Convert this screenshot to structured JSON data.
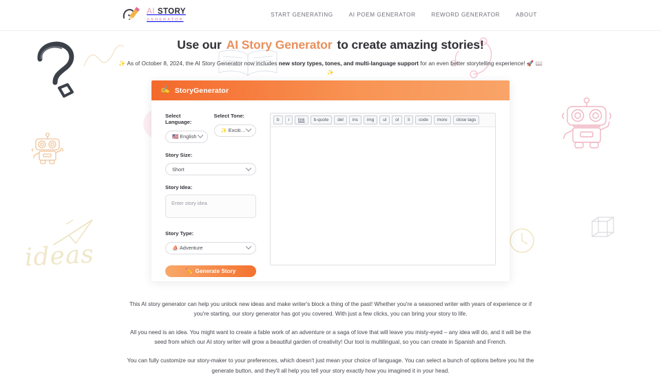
{
  "header": {
    "logo": {
      "icon": "pencil-logo-icon",
      "line1_prefix": "AI ",
      "line1_bold": "STORY",
      "line2": "GENERATOR"
    },
    "nav": [
      {
        "label": "START GENERATING",
        "name": "nav-start-generating"
      },
      {
        "label": "AI POEM GENERATOR",
        "name": "nav-ai-poem-generator"
      },
      {
        "label": "REWORD GENERATOR",
        "name": "nav-reword-generator"
      },
      {
        "label": "ABOUT",
        "name": "nav-about"
      }
    ]
  },
  "hero": {
    "title_before": "Use our",
    "title_accent": "AI Story Generator",
    "title_after": "to create amazing stories!",
    "notice_lead_icon": "✨",
    "notice_part1": "As of October 8, 2024, the AI Story Generator now includes ",
    "notice_bold": "new story types, tones, and multi-language support",
    "notice_part2": " for an even better storytelling experience! 🚀",
    "notice_trail": "📖✨"
  },
  "card": {
    "head_icon": "✍️",
    "head_title": "StoryGenerator",
    "fields": {
      "language_label": "Select Language:",
      "language_value": "🇺🇸 English",
      "tone_label": "Select Tone:",
      "tone_value": "✨ Exciting",
      "size_label": "Story Size:",
      "size_value": "Short",
      "idea_label": "Story Idea:",
      "idea_placeholder": "Enter story idea",
      "idea_value": "",
      "type_label": "Story Type:",
      "type_value": "⛵ Adventure"
    },
    "generate_button": {
      "icon": "✏️",
      "label": "Generate Story"
    },
    "editor": {
      "quicktags": [
        "b",
        "i",
        "link",
        "b-quote",
        "del",
        "ins",
        "img",
        "ul",
        "ol",
        "li",
        "code",
        "more",
        "close tags"
      ],
      "content": ""
    }
  },
  "copy": {
    "paragraphs": [
      "This AI story generator can help you unlock new ideas and make writer's block a thing of the past! Whether you're a seasoned writer with years of experience or if you're starting, our story generator has got you covered. With just a few clicks, you can bring your story to life.",
      "All you need is an idea. You might want to create a fable work of an adventure or a saga of love that will leave you misty-eyed – any idea will do, and it will be the seed from which our AI story writer will grow a beautiful garden of creativity! Our tool is multilingual, so you can create in Spanish and French.",
      "You can fully customize our story-maker to your preferences, which doesn't just mean your choice of language. You can select a bunch of options before you hit the generate button, and they'll all help you tell your story exactly how you imagined it in your head."
    ]
  },
  "decorations": {
    "ideas_word": "ideas",
    "colors": {
      "accent_orange": "#ef7a3a",
      "header_gradient_start": "#f4692c",
      "header_gradient_end": "#f9a469",
      "logo_pink": "#e9a3ba",
      "robot_pink": "#efb6c2",
      "robot_orange": "#f0c49a",
      "doodle_dark": "#3c4049",
      "doodle_pale": "#efe7c9"
    }
  }
}
